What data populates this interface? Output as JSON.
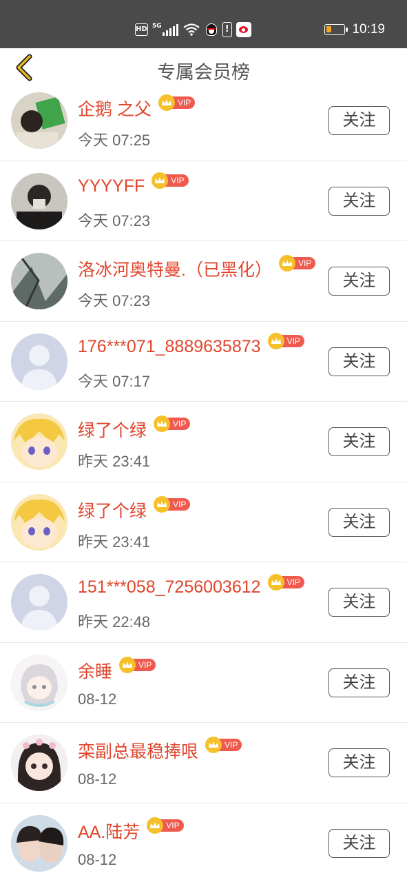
{
  "status_bar": {
    "network_badge": "HD",
    "network_type": "5G",
    "time": "10:19",
    "icons": [
      "hd-icon",
      "signal-icon",
      "wifi-icon",
      "qq-icon",
      "warning-icon",
      "weibo-icon",
      "battery-icon"
    ],
    "battery_level_pct": 20,
    "battery_color": "#f5a623"
  },
  "header": {
    "title": "专属会员榜",
    "back_icon": "chevron-left-icon",
    "back_icon_color": "#e8b923"
  },
  "vip_label": "VIP",
  "colors": {
    "name": "#e0452c",
    "vip_pill": "#ef5a4f",
    "crown": "#f6c02b"
  },
  "members": [
    {
      "name": "企鹅 之父",
      "time": "今天 07:25",
      "follow_label": "关注",
      "avatar": "photo-avatar"
    },
    {
      "name": "YYYYFF",
      "time": "今天 07:23",
      "follow_label": "关注",
      "avatar": "photo-avatar"
    },
    {
      "name": "洛冰河奥特曼.（已黑化）",
      "time": "今天 07:23",
      "follow_label": "关注",
      "avatar": "photo-avatar"
    },
    {
      "name": "176***071_8889635873",
      "time": "今天 07:17",
      "follow_label": "关注",
      "avatar": "default-avatar"
    },
    {
      "name": "绿了个绿",
      "time": "昨天 23:41",
      "follow_label": "关注",
      "avatar": "anime-avatar"
    },
    {
      "name": "绿了个绿",
      "time": "昨天 23:41",
      "follow_label": "关注",
      "avatar": "anime-avatar"
    },
    {
      "name": "151***058_7256003612",
      "time": "昨天 22:48",
      "follow_label": "关注",
      "avatar": "default-avatar"
    },
    {
      "name": "余睡",
      "time": "08-12",
      "follow_label": "关注",
      "avatar": "anime-avatar"
    },
    {
      "name": "栾副总最稳捧哏",
      "time": "08-12",
      "follow_label": "关注",
      "avatar": "anime-avatar"
    },
    {
      "name": "AA.陆芳",
      "time": "08-12",
      "follow_label": "关注",
      "avatar": "photo-avatar"
    }
  ]
}
